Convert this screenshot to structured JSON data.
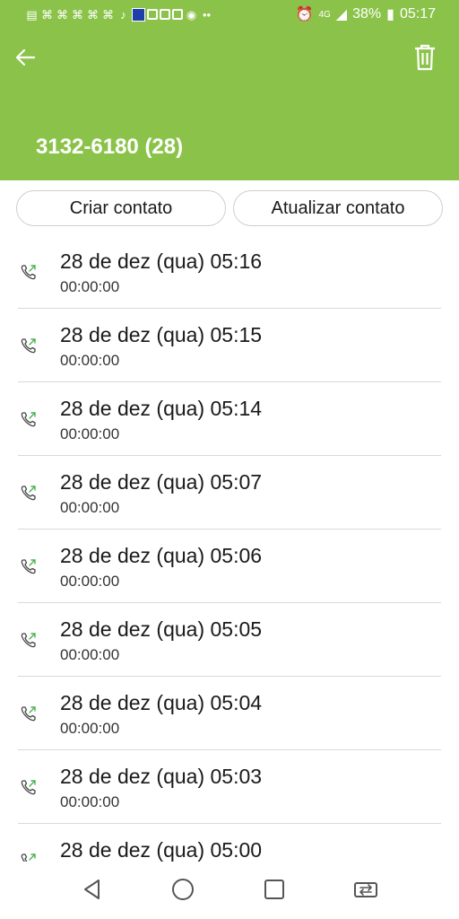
{
  "status_bar": {
    "battery": "38%",
    "time": "05:17",
    "network": "4G"
  },
  "header": {
    "title": "3132-6180 (28)",
    "color": "#8bc34a"
  },
  "buttons": {
    "create_contact": "Criar contato",
    "update_contact": "Atualizar contato"
  },
  "call_log": [
    {
      "date": "28 de dez (qua) 05:16",
      "duration": "00:00:00"
    },
    {
      "date": "28 de dez (qua) 05:15",
      "duration": "00:00:00"
    },
    {
      "date": "28 de dez (qua) 05:14",
      "duration": "00:00:00"
    },
    {
      "date": "28 de dez (qua) 05:07",
      "duration": "00:00:00"
    },
    {
      "date": "28 de dez (qua) 05:06",
      "duration": "00:00:00"
    },
    {
      "date": "28 de dez (qua) 05:05",
      "duration": "00:00:00"
    },
    {
      "date": "28 de dez (qua) 05:04",
      "duration": "00:00:00"
    },
    {
      "date": "28 de dez (qua) 05:03",
      "duration": "00:00:00"
    },
    {
      "date": "28 de dez (qua) 05:00",
      "duration": ""
    }
  ],
  "icons": {
    "back": "arrow-left-icon",
    "delete": "trash-icon",
    "call": "outgoing-call-icon",
    "nav_back": "triangle-back-icon",
    "nav_home": "circle-home-icon",
    "nav_recents": "square-recents-icon",
    "nav_switch": "switch-apps-icon"
  }
}
